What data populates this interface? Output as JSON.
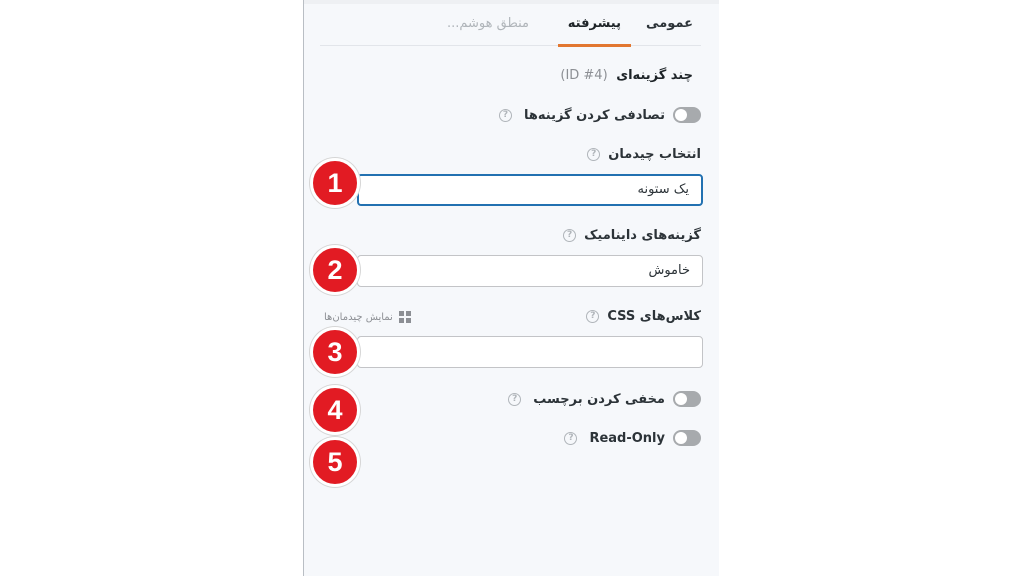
{
  "tabs": {
    "general": "عمومی",
    "advanced": "پیشرفته",
    "smart_logic": "منطق هوشم..."
  },
  "field": {
    "title": "چند گزینه‌ای",
    "id": "(ID #4)"
  },
  "settings": {
    "randomize_label": "تصادفی کردن گزینه‌ها",
    "layout_label": "انتخاب چیدمان",
    "layout_value": "یک ستونه",
    "dynamic_label": "گزینه‌های داینامیک",
    "dynamic_value": "خاموش",
    "css_label": "کلاس‌های CSS",
    "css_value": "",
    "show_layouts_link": "نمایش چیدمان‌ها",
    "hide_label": "مخفی کردن برچسب",
    "readonly_label": "Read-Only"
  },
  "help_glyph": "?",
  "badges": [
    "1",
    "2",
    "3",
    "4",
    "5"
  ],
  "colors": {
    "accent_tab": "#e27730",
    "badge_red": "#e21b23",
    "focus_blue": "#2271b1"
  }
}
